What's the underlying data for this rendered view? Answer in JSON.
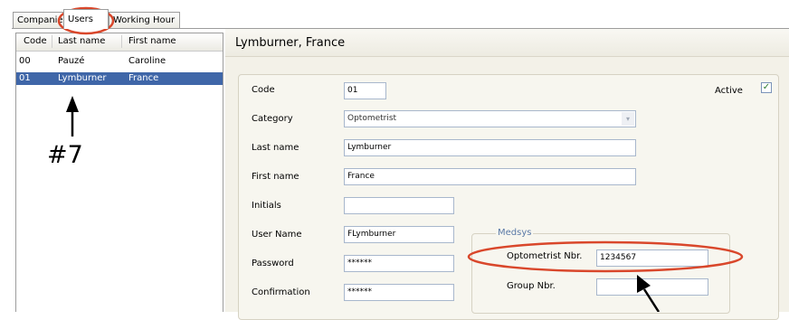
{
  "tabs": [
    {
      "label": "Companies"
    },
    {
      "label": "Users"
    },
    {
      "label": "Working Hour"
    }
  ],
  "user_list": {
    "columns": [
      "Code",
      "Last name",
      "First name"
    ],
    "rows": [
      {
        "code": "00",
        "last": "Pauzé",
        "first": "Caroline"
      },
      {
        "code": "01",
        "last": "Lymburner",
        "first": "France"
      }
    ]
  },
  "annotation": {
    "label": "#7"
  },
  "detail": {
    "title": "Lymburner, France",
    "code_label": "Code",
    "code_value": "01",
    "active_label": "Active",
    "active_checked": "✓",
    "category_label": "Category",
    "category_value": "Optometrist",
    "lastname_label": "Last name",
    "lastname_value": "Lymburner",
    "firstname_label": "First name",
    "firstname_value": "France",
    "initials_label": "Initials",
    "initials_value": "",
    "username_label": "User Name",
    "username_value": "FLymburner",
    "password_label": "Password",
    "password_value": "******",
    "confirmation_label": "Confirmation",
    "confirmation_value": "******"
  },
  "medsys": {
    "title": "Medsys",
    "optometrist_label": "Optometrist Nbr.",
    "optometrist_value": "1234567",
    "group_label": "Group Nbr.",
    "group_value": ""
  },
  "colors": {
    "selection": "#3f66a8",
    "annotation_red": "#d9472b",
    "medsys_title": "#5a79a7"
  }
}
